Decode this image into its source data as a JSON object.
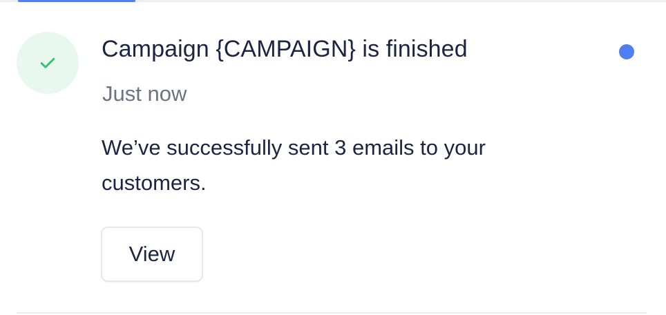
{
  "notification": {
    "status_icon": "check-icon",
    "title": "Campaign {CAMPAIGN} is finished",
    "time": "Just now",
    "body": "We’ve successfully sent 3 emails to your customers.",
    "action_label": "View",
    "unread": true
  },
  "colors": {
    "accent": "#4f7ff0",
    "success": "#34c36b",
    "success_bg": "#e9f8ee",
    "text_primary": "#1b2542",
    "text_secondary": "#6b7484"
  }
}
